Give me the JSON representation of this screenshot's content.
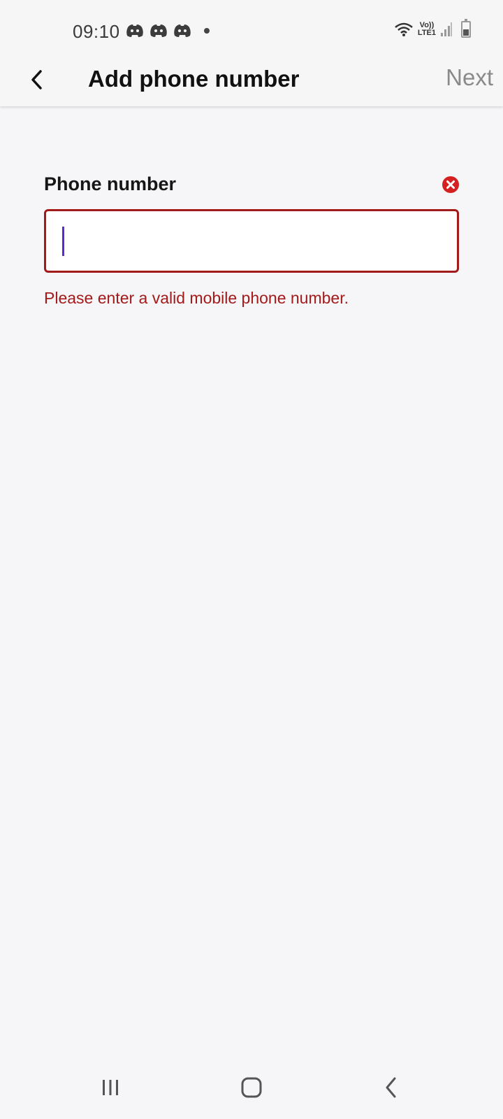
{
  "status_bar": {
    "time": "09:10",
    "notification_icons": [
      "discord-icon",
      "discord-icon",
      "discord-icon"
    ],
    "network_label_top": "Vo))",
    "network_label_bottom": "LTE1"
  },
  "app_bar": {
    "title": "Add phone number",
    "next_label": "Next"
  },
  "form": {
    "label": "Phone number",
    "value": "",
    "placeholder": "",
    "error_message": "Please enter a valid mobile phone number."
  },
  "colors": {
    "error": "#a31a1a",
    "caret": "#5b2bd0",
    "disabled_action": "#8a8a8a"
  },
  "nav_bar": {
    "buttons": [
      "recents-icon",
      "home-icon",
      "back-icon"
    ]
  }
}
